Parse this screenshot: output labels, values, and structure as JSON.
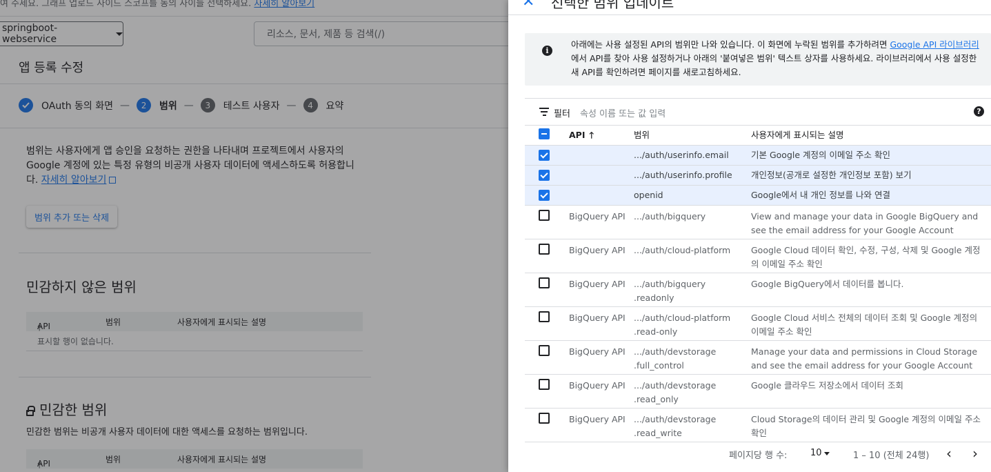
{
  "background": {
    "top_text": "여 주세요. 그래프 업로드 사이드 스코프를 동의 사이들 선택하세요.",
    "top_link": "자세히 알아보기",
    "project": "springboot-webservice",
    "search_placeholder": "리소스, 문서, 제품 등 검색(/)",
    "page_title": "앱 등록 수정",
    "steps": [
      {
        "num": "✓",
        "label": "OAuth 동의 화면",
        "state": "done"
      },
      {
        "num": "2",
        "label": "범위",
        "state": "active"
      },
      {
        "num": "3",
        "label": "테스트 사용자",
        "state": "todo"
      },
      {
        "num": "4",
        "label": "요약",
        "state": "todo"
      }
    ],
    "step_sep": "—",
    "desc_text": "범위는 사용자에게 앱 승인을 요청하는 권한을 나타내며 프로젝트에서 사용자의 Google 계정에 있는 특정 유형의 비공개 사용자 데이터에 액세스하도록 허용합니다.",
    "desc_link": "자세히 알아보기",
    "scope_button": "범위 추가 또는 삭제",
    "nonsensitive_title": "민감하지 않은 범위",
    "sensitive_title": "민감한 범위",
    "sensitive_desc": "민감한 범위는 비공개 사용자 데이터에 대한 액세스를 요청하는 범위입니다.",
    "table_headers": {
      "api": "API",
      "scope": "범위",
      "desc": "사용자에게 표시되는 설명"
    },
    "no_rows": "표시할 행이 없습니다."
  },
  "panel": {
    "close": "✕",
    "title": "선택한 범위 업데이트",
    "info_text_1": "아래에는 사용 설정된 API의 범위만 나와 있습니다. 이 화면에 누락된 범위를 추가하려면 ",
    "info_link": "Google API 라이브러리",
    "info_text_2": "에서 API를 찾아 사용 설정하거나 아래의 '붙여넣은 범위' 텍스트 상자를 사용하세요. 라이브러리에서 사용 설정한 새 API를 확인하려면 페이지를 새로고침하세요.",
    "filter_label": "필터",
    "filter_placeholder": "속성 이름 또는 값 입력",
    "headers": {
      "api": "API",
      "scope": "범위",
      "desc": "사용자에게 표시되는 설명"
    },
    "rows": [
      {
        "checked": true,
        "api": "",
        "scope": ".../auth/userinfo.email",
        "desc": "기본 Google 계정의 이메일 주소 확인"
      },
      {
        "checked": true,
        "api": "",
        "scope": ".../auth/userinfo.profile",
        "desc": "개인정보(공개로 설정한 개인정보 포함) 보기"
      },
      {
        "checked": true,
        "api": "",
        "scope": "openid",
        "desc": "Google에서 내 개인 정보를 나와 연결"
      },
      {
        "checked": false,
        "api": "BigQuery API",
        "scope": ".../auth/bigquery",
        "desc": "View and manage your data in Google BigQuery and see the email address for your Google Account"
      },
      {
        "checked": false,
        "api": "BigQuery API",
        "scope": ".../auth/cloud-platform",
        "desc": "Google Cloud 데이터 확인, 수정, 구성, 삭제 및 Google 계정의 이메일 주소 확인"
      },
      {
        "checked": false,
        "api": "BigQuery API",
        "scope": ".../auth/bigquery .readonly",
        "desc": "Google BigQuery에서 데이터를 봅니다."
      },
      {
        "checked": false,
        "api": "BigQuery API",
        "scope": ".../auth/cloud-platform .read-only",
        "desc": "Google Cloud 서비스 전체의 데이터 조회 및 Google 계정의 이메일 주소 확인"
      },
      {
        "checked": false,
        "api": "BigQuery API",
        "scope": ".../auth/devstorage .full_control",
        "desc": "Manage your data and permissions in Cloud Storage and see the email address for your Google Account"
      },
      {
        "checked": false,
        "api": "BigQuery API",
        "scope": ".../auth/devstorage .read_only",
        "desc": "Google 클라우드 저장소에서 데이터 조회"
      },
      {
        "checked": false,
        "api": "BigQuery API",
        "scope": ".../auth/devstorage .read_write",
        "desc": "Cloud Storage의 데이터 관리 및 Google 계정의 이메일 주소 확인"
      }
    ],
    "pager": {
      "rows_per_page_label": "페이지당 행 수:",
      "rows_per_page": "10",
      "range": "1 – 10 (전체 24행)",
      "prev": "‹",
      "next": "›"
    }
  }
}
